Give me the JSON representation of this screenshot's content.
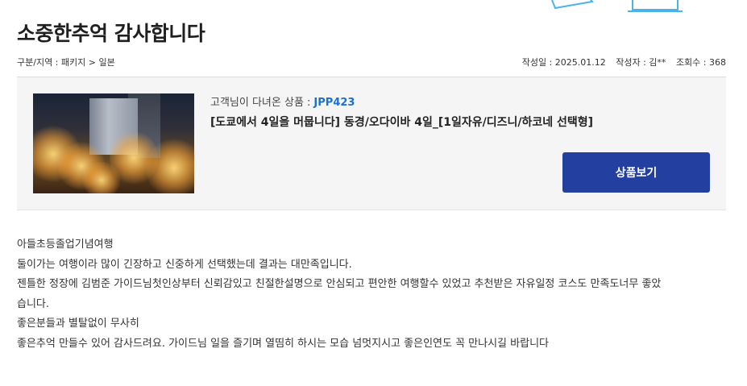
{
  "review": {
    "title": "소중한추억 감사합니다",
    "category": "구분/지역 : 패키지 > 일본",
    "date": "작성일 : 2025.01.12",
    "author": "작성자 : 김**",
    "views": "조회수 : 368"
  },
  "product": {
    "code_label": "고객님이 다녀온 상품 :",
    "code": "JPP423",
    "name": "[도쿄에서 4일을 머뭅니다] 동경/오다이바 4일_[1일자유/디즈니/하코네 선택형]",
    "view_button": "상품보기",
    "thumbnail_icon": "illuminated-city-photo"
  },
  "content": {
    "lines": [
      "아들초등졸업기념여행",
      "둘이가는 여행이라 많이 긴장하고 신중하게 선택했는데 결과는 대만족입니다.",
      "젠틀한 정장에 김범준 가이드님첫인상부터 신뢰감있고 친절한설명으로 안심되고 편안한 여행할수 있었고 추천받은 자유일정 코스도 만족도너무 좋았",
      "습니다.",
      "좋은분들과 별탈없이 무사히",
      "좋은추억 만들수 있어 감사드려요. 가이드님 일을 즐기며 열띰히 하시는 모습 넘멋지시고 좋은인연도 꼭 만나시길 바랍니다"
    ]
  },
  "colors": {
    "accent_button": "#233fa0",
    "code_blue": "#1f6fd0",
    "deco_line": "#4ab3e8",
    "box_bg": "#f5f5f5"
  }
}
